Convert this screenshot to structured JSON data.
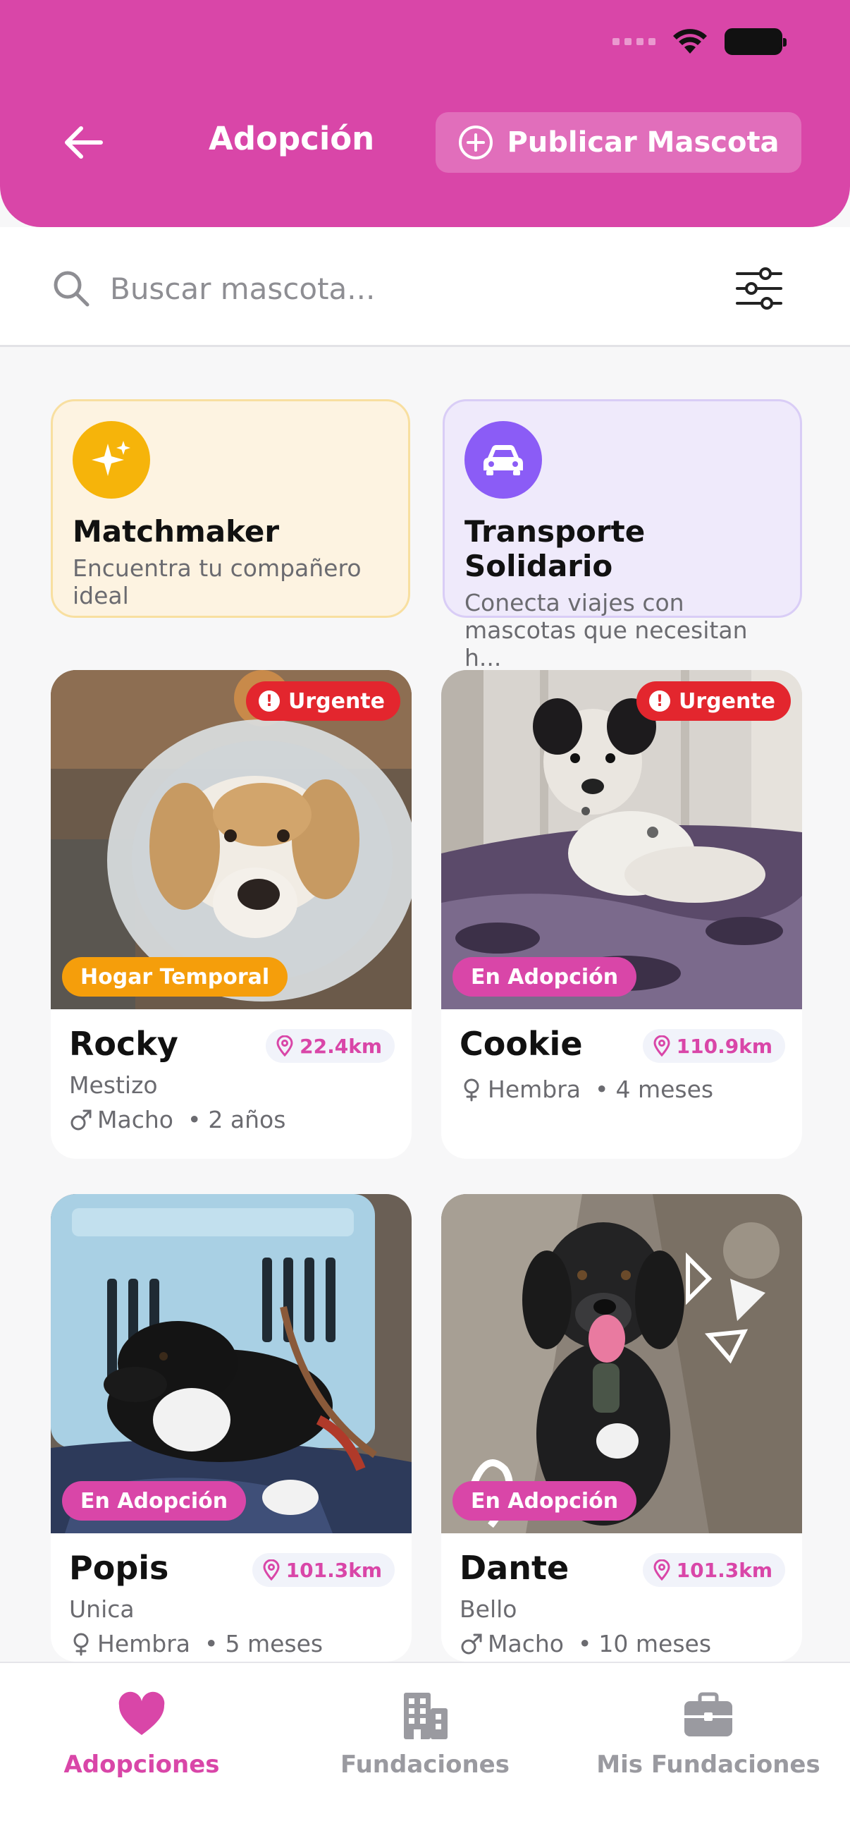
{
  "colors": {
    "primary": "#d946a8",
    "urgent": "#e3262e",
    "temporal": "#f59e0b",
    "matchmaker": "#f6b40a",
    "transport": "#8b5cf6"
  },
  "header": {
    "title": "Adopción",
    "publish_label": "Publicar Mascota",
    "back_icon": "arrow-left-icon"
  },
  "search": {
    "placeholder": "Buscar mascota...",
    "value": ""
  },
  "features": [
    {
      "title": "Matchmaker",
      "description": "Encuentra tu compañero ideal",
      "icon": "sparkles-icon"
    },
    {
      "title": "Transporte Solidario",
      "description": "Conecta viajes con mascotas que necesitan h...",
      "icon": "car-icon"
    }
  ],
  "pets": [
    {
      "name": "Rocky",
      "distance": "22.4km",
      "breed": "Mestizo",
      "sex": "Macho",
      "age": "2 años",
      "status": "Hogar Temporal",
      "urgent_label": "Urgente"
    },
    {
      "name": "Cookie",
      "distance": "110.9km",
      "breed": "",
      "sex": "Hembra",
      "age": "4 meses",
      "status": "En Adopción",
      "urgent_label": "Urgente"
    },
    {
      "name": "Popis",
      "distance": "101.3km",
      "breed": "Unica",
      "sex": "Hembra",
      "age": "5 meses",
      "status": "En Adopción"
    },
    {
      "name": "Dante",
      "distance": "101.3km",
      "breed": "Bello",
      "sex": "Macho",
      "age": "10 meses",
      "status": "En Adopción"
    }
  ],
  "nav": [
    {
      "label": "Adopciones",
      "icon": "heart-icon",
      "active": true
    },
    {
      "label": "Fundaciones",
      "icon": "building-icon",
      "active": false
    },
    {
      "label": "Mis Fundaciones",
      "icon": "briefcase-icon",
      "active": false
    }
  ]
}
